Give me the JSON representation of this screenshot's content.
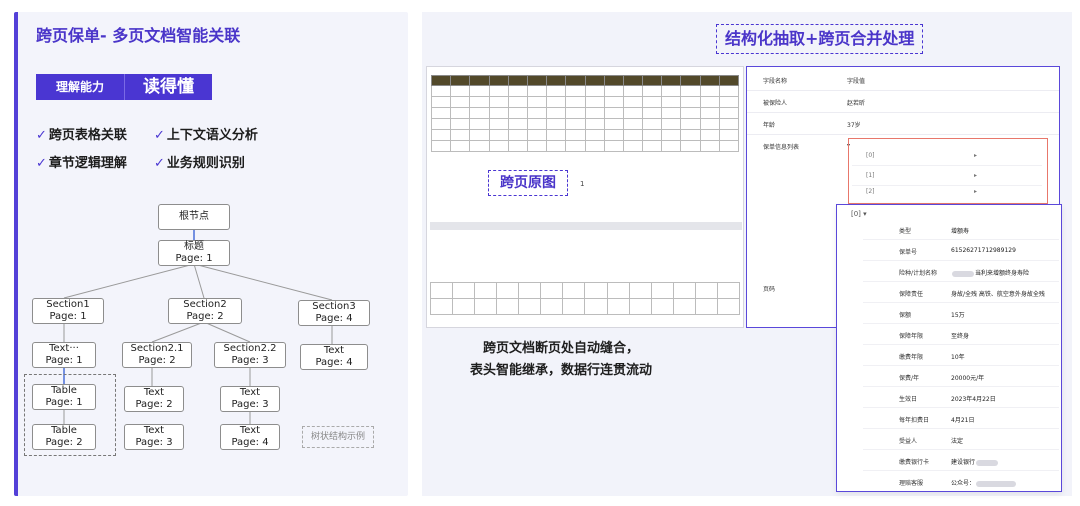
{
  "left": {
    "title": "跨页保单- 多页文档智能关联",
    "ability_label": "理解能力",
    "ability_value": "读得懂",
    "features": [
      "跨页表格关联",
      "上下文语义分析",
      "章节逻辑理解",
      "业务规则识别"
    ],
    "check": "✓",
    "tree": {
      "root": "根节点",
      "title": [
        "标题",
        "Page: 1"
      ],
      "section1": [
        "Section1",
        "Page: 1"
      ],
      "section2": [
        "Section2",
        "Page: 2"
      ],
      "section3": [
        "Section3",
        "Page: 4"
      ],
      "text_s1": [
        "Text···",
        "Page: 1"
      ],
      "section21": [
        "Section2.1",
        "Page: 2"
      ],
      "section22": [
        "Section2.2",
        "Page: 3"
      ],
      "text_s3": [
        "Text",
        "Page: 4"
      ],
      "table1": [
        "Table",
        "Page: 1"
      ],
      "text21": [
        "Text",
        "Page: 2"
      ],
      "text22": [
        "Text",
        "Page: 3"
      ],
      "table2": [
        "Table",
        "Page: 2"
      ],
      "text21b": [
        "Text",
        "Page: 3"
      ],
      "text22b": [
        "Text",
        "Page: 4"
      ],
      "example_label": "树状结构示例"
    }
  },
  "right": {
    "title": "结构化抽取+跨页合并处理",
    "original_label": "跨页原图",
    "original_num": "1",
    "caption_line1": "跨页文档断页处自动缝合，",
    "caption_line2": "表头智能继承，数据行连贯流动",
    "fields": [
      {
        "k": "字段名称",
        "v": "字段值"
      },
      {
        "k": "被保险人",
        "v": "赵若昕"
      },
      {
        "k": "年龄",
        "v": "37岁"
      },
      {
        "k": "保单信息列表",
        "v": "▾"
      }
    ],
    "sub_items": [
      "[0]",
      "[1]",
      "[2]"
    ],
    "sub_marker": "▸",
    "page_field": "页码",
    "detail_index": "[0]",
    "detail_marker": "▾",
    "details": [
      {
        "k": "类型",
        "v": "增额寿"
      },
      {
        "k": "保单号",
        "v": "61526271712989129"
      },
      {
        "k": "险种/计划名称",
        "v": "当利来增额终身寿险"
      },
      {
        "k": "保障责任",
        "v": "身故/全残 高铁、航空意外身故全残"
      },
      {
        "k": "保额",
        "v": "15万"
      },
      {
        "k": "保障年限",
        "v": "至终身"
      },
      {
        "k": "缴费年限",
        "v": "10年"
      },
      {
        "k": "保费/年",
        "v": "20000元/年"
      },
      {
        "k": "生效日",
        "v": "2023年4月22日"
      },
      {
        "k": "每年扣费日",
        "v": "4月21日"
      },
      {
        "k": "受益人",
        "v": "法定"
      },
      {
        "k": "缴费银行卡",
        "v": "建设银行"
      },
      {
        "k": "理赔客服",
        "v": "公众号："
      }
    ]
  }
}
